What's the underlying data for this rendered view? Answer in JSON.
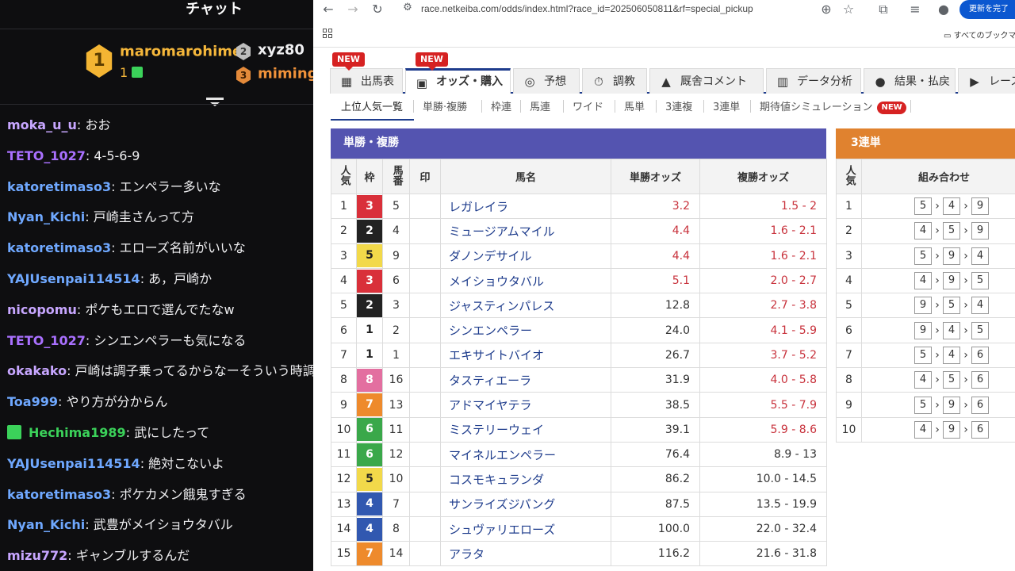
{
  "chat": {
    "title": "チャット",
    "leaderboard": {
      "first": {
        "rank": "1",
        "name": "maromarohime",
        "count": "1"
      },
      "second": {
        "rank": "2",
        "name": "xyz80"
      },
      "third": {
        "rank": "3",
        "name": "miminga"
      }
    },
    "messages": [
      {
        "user": "moka_u_u",
        "color": "#c7a6ff",
        "text": "おお"
      },
      {
        "user": "TETO_1027",
        "color": "#a970ff",
        "text": "4-5-6-9"
      },
      {
        "user": "katoretimaso3",
        "color": "#6fa8ff",
        "text": "エンペラー多いな"
      },
      {
        "user": "Nyan_Kichi",
        "color": "#6fa8ff",
        "text": "戸崎圭さんって方"
      },
      {
        "user": "katoretimaso3",
        "color": "#6fa8ff",
        "text": "エローズ名前がいいな"
      },
      {
        "user": "YAJUsenpai114514",
        "color": "#6fa8ff",
        "text": "あ，戸崎か"
      },
      {
        "user": "nicopomu",
        "color": "#c7a6ff",
        "text": "ポケもエロで選んでたなw"
      },
      {
        "user": "TETO_1027",
        "color": "#a970ff",
        "text": "シンエンペラーも気になる"
      },
      {
        "user": "okakako",
        "color": "#c7a6ff",
        "text": "戸崎は調子乗ってるからなーそういう時調"
      },
      {
        "user": "Toa999",
        "color": "#6fa8ff",
        "text": "やり方が分からん"
      },
      {
        "user": "Hechima1989",
        "color": "#3bd25a",
        "text": "武にしたって",
        "gift": true
      },
      {
        "user": "YAJUsenpai114514",
        "color": "#6fa8ff",
        "text": "絶対こないよ"
      },
      {
        "user": "katoretimaso3",
        "color": "#6fa8ff",
        "text": "ポケカメン餓鬼すぎる"
      },
      {
        "user": "Nyan_Kichi",
        "color": "#6fa8ff",
        "text": "武豊がメイショウタバル"
      },
      {
        "user": "mizu772",
        "color": "#c7a6ff",
        "text": "ギャンブルするんだ"
      }
    ]
  },
  "browser": {
    "url": "race.netkeiba.com/odds/index.html?race_id=202506050811&rf=special_pickup",
    "update_button": "更新を完了",
    "bookmarks_label": "すべてのブックマーク"
  },
  "page": {
    "main_tabs": [
      {
        "label": "出馬表",
        "icon": "table-icon",
        "glyph": "▦"
      },
      {
        "label": "オッズ・購入",
        "icon": "odds-icon",
        "glyph": "▣",
        "active": true
      },
      {
        "label": "予想",
        "icon": "target-icon",
        "glyph": "◎"
      },
      {
        "label": "調教",
        "icon": "stopwatch-icon",
        "glyph": "⏱"
      },
      {
        "label": "厩舎コメント",
        "icon": "stable-icon",
        "glyph": "▲"
      },
      {
        "label": "データ分析",
        "icon": "bar-chart-icon",
        "glyph": "▥"
      },
      {
        "label": "結果・払戻",
        "icon": "coins-icon",
        "glyph": "●"
      },
      {
        "label": "レース",
        "icon": "video-icon",
        "glyph": "▶"
      }
    ],
    "new_badge": "NEW",
    "sub_tabs": [
      "上位人気一覧",
      "単勝·複勝",
      "枠連",
      "馬連",
      "ワイド",
      "馬単",
      "3連複",
      "3連単",
      "期待値シミュレーション"
    ],
    "win_place": {
      "title": "単勝・複勝",
      "headers": {
        "popularity": "人気",
        "waku": "枠",
        "umaban": "馬番",
        "mark": "印",
        "name": "馬名",
        "win": "単勝オッズ",
        "place": "複勝オッズ"
      },
      "rows": [
        {
          "pop": "1",
          "waku": "3",
          "uma": "5",
          "name": "レガレイラ",
          "win": "3.2",
          "place": "1.5 - 2",
          "hot": true
        },
        {
          "pop": "2",
          "waku": "2",
          "uma": "4",
          "name": "ミュージアムマイル",
          "win": "4.4",
          "place": "1.6 - 2.1",
          "hot": true
        },
        {
          "pop": "3",
          "waku": "5",
          "uma": "9",
          "name": "ダノンデサイル",
          "win": "4.4",
          "place": "1.6 - 2.1",
          "hot": true
        },
        {
          "pop": "4",
          "waku": "3",
          "uma": "6",
          "name": "メイショウタバル",
          "win": "5.1",
          "place": "2.0 - 2.7",
          "hot": true
        },
        {
          "pop": "5",
          "waku": "2",
          "uma": "3",
          "name": "ジャスティンパレス",
          "win": "12.8",
          "place": "2.7 - 3.8",
          "hot": false,
          "place_hot": true
        },
        {
          "pop": "6",
          "waku": "1",
          "uma": "2",
          "name": "シンエンペラー",
          "win": "24.0",
          "place": "4.1 - 5.9",
          "hot": false,
          "place_hot": true
        },
        {
          "pop": "7",
          "waku": "1",
          "uma": "1",
          "name": "エキサイトバイオ",
          "win": "26.7",
          "place": "3.7 - 5.2",
          "hot": false,
          "place_hot": true
        },
        {
          "pop": "8",
          "waku": "8",
          "uma": "16",
          "name": "タスティエーラ",
          "win": "31.9",
          "place": "4.0 - 5.8",
          "hot": false,
          "place_hot": true
        },
        {
          "pop": "9",
          "waku": "7",
          "uma": "13",
          "name": "アドマイヤテラ",
          "win": "38.5",
          "place": "5.5 - 7.9",
          "hot": false,
          "place_hot": true
        },
        {
          "pop": "10",
          "waku": "6",
          "uma": "11",
          "name": "ミステリーウェイ",
          "win": "39.1",
          "place": "5.9 - 8.6",
          "hot": false,
          "place_hot": true
        },
        {
          "pop": "11",
          "waku": "6",
          "uma": "12",
          "name": "マイネルエンペラー",
          "win": "76.4",
          "place": "8.9 - 13",
          "hot": false
        },
        {
          "pop": "12",
          "waku": "5",
          "uma": "10",
          "name": "コスモキュランダ",
          "win": "86.2",
          "place": "10.0 - 14.5",
          "hot": false
        },
        {
          "pop": "13",
          "waku": "4",
          "uma": "7",
          "name": "サンライズジパング",
          "win": "87.5",
          "place": "13.5 - 19.9",
          "hot": false
        },
        {
          "pop": "14",
          "waku": "4",
          "uma": "8",
          "name": "シュヴァリエローズ",
          "win": "100.0",
          "place": "22.0 - 32.4",
          "hot": false
        },
        {
          "pop": "15",
          "waku": "7",
          "uma": "14",
          "name": "アラタ",
          "win": "116.2",
          "place": "21.6 - 31.8",
          "hot": false
        }
      ]
    },
    "trifecta": {
      "title": "3連単",
      "headers": {
        "popularity": "人気",
        "combo": "組み合わせ"
      },
      "rows": [
        {
          "pop": "1",
          "combo": [
            "5",
            "4",
            "9"
          ]
        },
        {
          "pop": "2",
          "combo": [
            "4",
            "5",
            "9"
          ]
        },
        {
          "pop": "3",
          "combo": [
            "5",
            "9",
            "4"
          ]
        },
        {
          "pop": "4",
          "combo": [
            "4",
            "9",
            "5"
          ]
        },
        {
          "pop": "5",
          "combo": [
            "9",
            "5",
            "4"
          ]
        },
        {
          "pop": "6",
          "combo": [
            "9",
            "4",
            "5"
          ]
        },
        {
          "pop": "7",
          "combo": [
            "5",
            "4",
            "6"
          ]
        },
        {
          "pop": "8",
          "combo": [
            "4",
            "5",
            "6"
          ]
        },
        {
          "pop": "9",
          "combo": [
            "5",
            "9",
            "6"
          ]
        },
        {
          "pop": "10",
          "combo": [
            "4",
            "9",
            "6"
          ]
        }
      ]
    },
    "waku_colors": {
      "1": {
        "bg": "#ffffff",
        "fg": "#222222"
      },
      "2": {
        "bg": "#222222",
        "fg": "#ffffff"
      },
      "3": {
        "bg": "#d9303a",
        "fg": "#ffffff"
      },
      "4": {
        "bg": "#3158b0",
        "fg": "#ffffff"
      },
      "5": {
        "bg": "#f2d94a",
        "fg": "#222222"
      },
      "6": {
        "bg": "#3aa84a",
        "fg": "#ffffff"
      },
      "7": {
        "bg": "#ee8a2c",
        "fg": "#ffffff"
      },
      "8": {
        "bg": "#e36fa0",
        "fg": "#ffffff"
      }
    }
  }
}
